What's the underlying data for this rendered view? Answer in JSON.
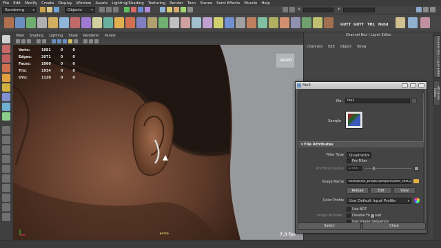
{
  "menubar": {
    "items": [
      "File",
      "Edit",
      "Modify",
      "Create",
      "Display",
      "Window",
      "Assets",
      "Lighting/Shading",
      "Texturing",
      "Render",
      "Toon",
      "Stereo",
      "Paint Effects",
      "Muscle",
      "Help"
    ]
  },
  "statusline": {
    "menu_set": "Rendering",
    "selection_mode": "Objects",
    "coord_x_label": "X:",
    "coord_y_label": "Y:"
  },
  "shelf": {
    "labels": [
      "GUTT",
      "GUTT",
      "TH1",
      "Hshd"
    ]
  },
  "viewport": {
    "menu": [
      "View",
      "Shading",
      "Lighting",
      "Show",
      "Renderer",
      "Panels"
    ],
    "hud": [
      {
        "label": "Verts:",
        "value": "1081",
        "v2": "0",
        "v3": "0"
      },
      {
        "label": "Edges:",
        "value": "2071",
        "v2": "0",
        "v3": "0"
      },
      {
        "label": "Faces:",
        "value": "1060",
        "v2": "0",
        "v3": "0"
      },
      {
        "label": "Tris:",
        "value": "1934",
        "v2": "0",
        "v3": "0"
      },
      {
        "label": "UVs:",
        "value": "1120",
        "v2": "0",
        "v3": "0"
      }
    ],
    "view_cube_label": "RIGHT",
    "fps": "7.3 fps",
    "camera_label": "persp"
  },
  "channel_box": {
    "title": "Channel Box / Layer Editor",
    "menu": [
      "Channels",
      "Edit",
      "Object",
      "Show"
    ],
    "side_tabs": [
      "Channel Box / Layer Editor",
      "Attribute Editor"
    ]
  },
  "file_dialog": {
    "title": "file3",
    "file_label": "file:",
    "file_value": "file3",
    "sample_label": "Sample",
    "section_title": "File Attributes",
    "filter_type_label": "Filter Type",
    "filter_type_value": "Quadratic",
    "pre_filter_label": "Pre Filter",
    "pre_filter_radius_label": "Pre Filter Radius",
    "pre_filter_radius_value": "2.000",
    "image_name_label": "Image Name",
    "image_name_value": "esktop\\tut_project\\project\\color_test.psd",
    "reload_label": "Reload",
    "edit_label": "Edit",
    "view_label": "View",
    "color_profile_label": "Color Profile",
    "color_profile_value": "Use Default Input Profile",
    "use_bot_label": "Use BOT",
    "disable_file_load_label": "Disable File Load",
    "use_image_sequence_label": "Use Image Sequence",
    "image_number_label": "Image Number",
    "select_label": "Select",
    "close_label": "Close"
  },
  "colors": {
    "viewport_bg": "#98999c",
    "skin_dark": "#4a2f22",
    "skin_mid": "#7a4e38",
    "hair": "#1c1410"
  }
}
